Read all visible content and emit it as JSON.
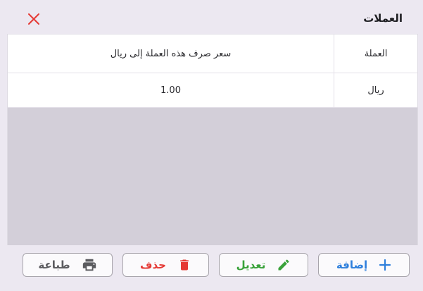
{
  "dialog": {
    "title": "العملات"
  },
  "table": {
    "columns": {
      "currency": "العملة",
      "rate": "سعر صرف هذه العملة إلى ريال"
    },
    "rows": [
      {
        "currency": "ريال",
        "rate": "1.00"
      }
    ]
  },
  "buttons": {
    "add": "إضافة",
    "edit": "تعديل",
    "delete": "حذف",
    "print": "طباعة"
  },
  "colors": {
    "background": "#ece8f1",
    "close": "#e53935",
    "add": "#2e7fdc",
    "edit": "#39a23a",
    "delete": "#e53935",
    "print": "#5b5b5f"
  },
  "icons": {
    "close": "close-icon",
    "add": "plus-icon",
    "edit": "pencil-icon",
    "delete": "trash-icon",
    "print": "printer-icon"
  }
}
